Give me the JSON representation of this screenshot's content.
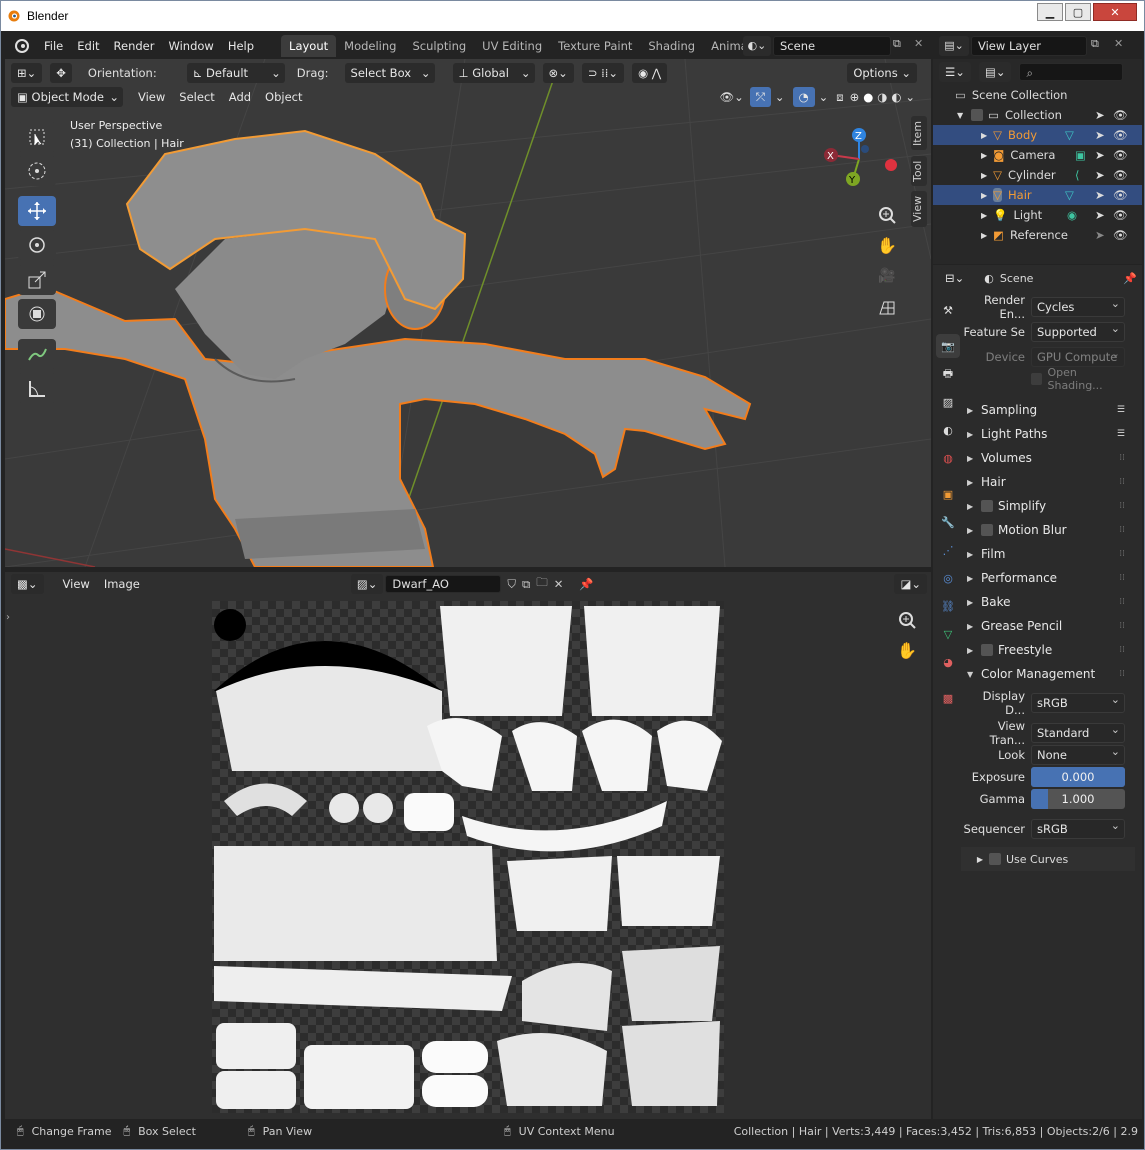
{
  "window": {
    "title": "Blender"
  },
  "menu": [
    "File",
    "Edit",
    "Render",
    "Window",
    "Help"
  ],
  "workspaces": [
    "Layout",
    "Modeling",
    "Sculpting",
    "UV Editing",
    "Texture Paint",
    "Shading",
    "Animation"
  ],
  "scene_field": "Scene",
  "view_layer_field": "View Layer",
  "viewport": {
    "orientation_label": "Orientation:",
    "orientation_value": "Default",
    "drag_label": "Drag:",
    "drag_value": "Select Box",
    "transform_space": "Global",
    "options_label": "Options",
    "mode": "Object Mode",
    "menus": [
      "View",
      "Select",
      "Add",
      "Object"
    ],
    "overlay_line1": "User Perspective",
    "overlay_line2": "(31) Collection | Hair",
    "side_tabs": [
      "Item",
      "Tool",
      "View"
    ],
    "gizmo": {
      "x": "X",
      "y": "Y",
      "z": "Z"
    },
    "colors": {
      "x": "#c8394a",
      "y": "#7ea623",
      "z": "#2f84e0",
      "outline": "#f27d1c"
    }
  },
  "image_editor": {
    "menus": [
      "View",
      "Image"
    ],
    "image_name": "Dwarf_AO"
  },
  "outliner": {
    "root": "Scene Collection",
    "collection": "Collection",
    "items": [
      {
        "name": "Body",
        "type": "mesh",
        "selected": true,
        "active": true
      },
      {
        "name": "Camera",
        "type": "camera",
        "selected": false
      },
      {
        "name": "Cylinder",
        "type": "mesh",
        "selected": false
      },
      {
        "name": "Hair",
        "type": "mesh",
        "selected": true,
        "active": false
      },
      {
        "name": "Light",
        "type": "light",
        "selected": false
      },
      {
        "name": "Reference",
        "type": "image",
        "selected": false
      }
    ]
  },
  "properties": {
    "context": "Scene",
    "render_engine_label": "Render En...",
    "render_engine": "Cycles",
    "feature_set_label": "Feature Se",
    "feature_set": "Supported",
    "device_label": "Device",
    "device": "GPU Compute",
    "open_shading": "Open Shading...",
    "panels": [
      {
        "label": "Sampling",
        "checkbox": false,
        "list": true
      },
      {
        "label": "Light Paths",
        "checkbox": false,
        "list": true
      },
      {
        "label": "Volumes",
        "checkbox": false,
        "list": false
      },
      {
        "label": "Hair",
        "checkbox": false,
        "list": false
      },
      {
        "label": "Simplify",
        "checkbox": true,
        "list": false
      },
      {
        "label": "Motion Blur",
        "checkbox": true,
        "list": false
      },
      {
        "label": "Film",
        "checkbox": false,
        "list": false
      },
      {
        "label": "Performance",
        "checkbox": false,
        "list": false
      },
      {
        "label": "Bake",
        "checkbox": false,
        "list": false
      },
      {
        "label": "Grease Pencil",
        "checkbox": false,
        "list": false
      },
      {
        "label": "Freestyle",
        "checkbox": true,
        "list": false
      },
      {
        "label": "Color Management",
        "checkbox": false,
        "list": false,
        "open": true
      }
    ],
    "color_management": {
      "display_label": "Display D...",
      "display": "sRGB",
      "view_label": "View Tran...",
      "view": "Standard",
      "look_label": "Look",
      "look": "None",
      "exposure_label": "Exposure",
      "exposure": "0.000",
      "exposure_fill": 1.0,
      "gamma_label": "Gamma",
      "gamma": "1.000",
      "gamma_fill": 0.18,
      "sequencer_label": "Sequencer",
      "sequencer": "sRGB",
      "use_curves": "Use Curves"
    }
  },
  "status": {
    "change_frame": "Change Frame",
    "box_select": "Box Select",
    "pan_view": "Pan View",
    "uv_menu": "UV Context Menu",
    "stats": "Collection | Hair | Verts:3,449 | Faces:3,452 | Tris:6,853 | Objects:2/6 | 2.9"
  }
}
